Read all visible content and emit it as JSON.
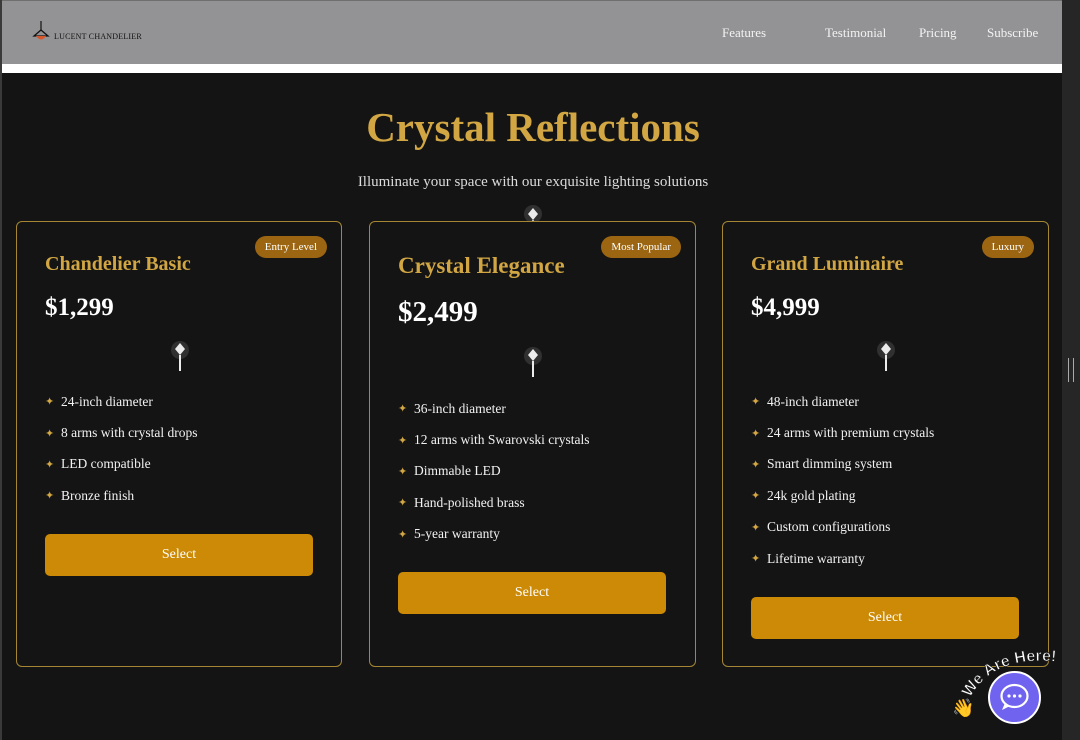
{
  "brand": {
    "name": "LUCENT CHANDELIER",
    "icon": "chandelier-icon"
  },
  "nav": [
    "Features",
    "Testimonial",
    "Pricing",
    "Subscribe"
  ],
  "hero": {
    "title": "Crystal Reflections",
    "subtitle": "Illuminate your space with our exquisite lighting solutions"
  },
  "cards": [
    {
      "badge": "Entry Level",
      "title": "Chandelier Basic",
      "price": "$1,299",
      "features": [
        "24-inch diameter",
        "8 arms with crystal drops",
        "LED compatible",
        "Bronze finish"
      ],
      "button": "Select"
    },
    {
      "badge": "Most Popular",
      "title": "Crystal Elegance",
      "price": "$2,499",
      "features": [
        "36-inch diameter",
        "12 arms with Swarovski crystals",
        "Dimmable LED",
        "Hand-polished brass",
        "5-year warranty"
      ],
      "button": "Select"
    },
    {
      "badge": "Luxury",
      "title": "Grand Luminaire",
      "price": "$4,999",
      "features": [
        "48-inch diameter",
        "24 arms with premium crystals",
        "Smart dimming system",
        "24k gold plating",
        "Custom configurations",
        "Lifetime warranty"
      ],
      "button": "Select"
    }
  ],
  "chat_widget": {
    "label": "We Are Here!",
    "icon": "chat-bubble-icon",
    "wave_icon": "waving-hand-icon"
  },
  "colors": {
    "accent_gold": "#d1a643",
    "button": "#cc8a06",
    "badge": "#9c6512",
    "background": "#141414",
    "navbar": "#939395",
    "chat": "#6f63f0"
  }
}
